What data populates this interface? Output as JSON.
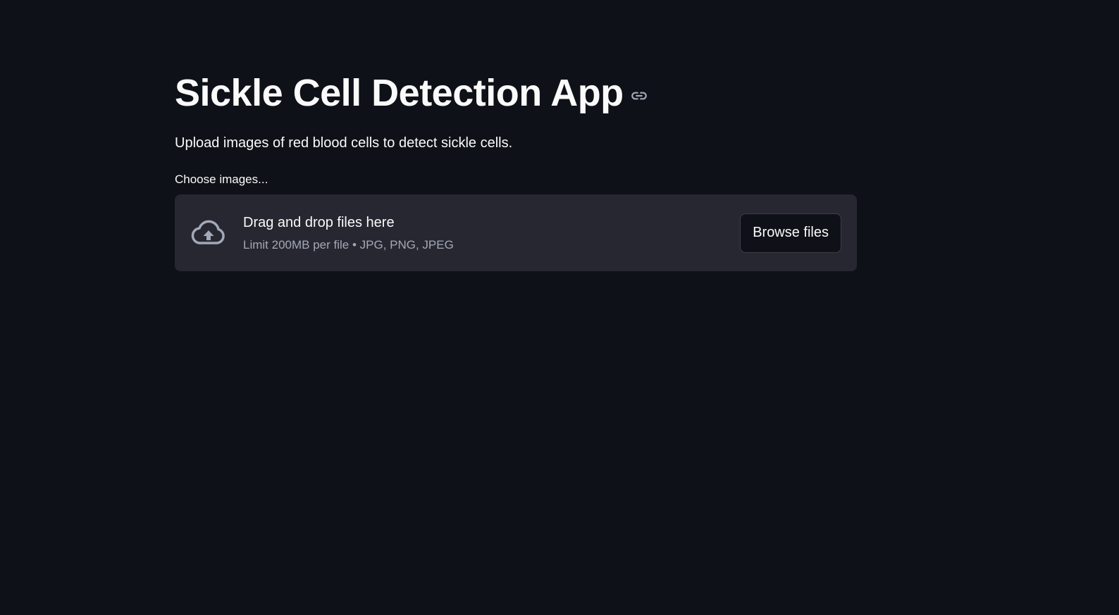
{
  "page": {
    "title": "Sickle Cell Detection App",
    "title_anchor_icon": "link-icon",
    "description": "Upload images of red blood cells to detect sickle cells."
  },
  "uploader": {
    "label": "Choose images...",
    "icon": "cloud-upload-icon",
    "instructions": "Drag and drop files here",
    "limits": "Limit 200MB per file • JPG, PNG, JPEG",
    "browse_label": "Browse files"
  },
  "colors": {
    "background": "#0e1117",
    "dropzone": "#262730",
    "text": "#fafafa",
    "muted_text": "#a3a8b8"
  }
}
